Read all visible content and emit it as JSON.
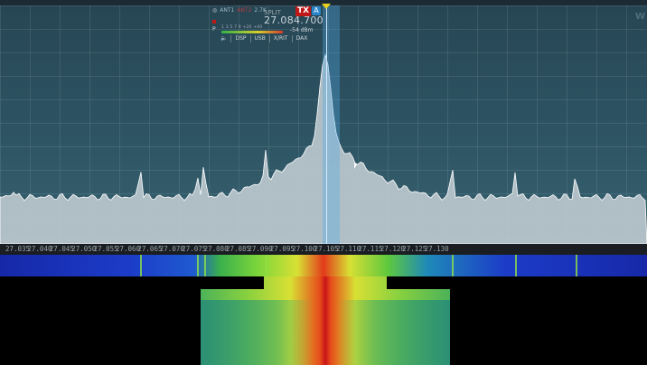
{
  "flag": {
    "ant1": "ANT1",
    "ant2": "ANT2",
    "bandwidth": "2.7K",
    "split": "SPLIT",
    "tx": "TX",
    "rx_letter": "A",
    "frequency": "27.084.700",
    "smeter_label": "P",
    "smeter_scale": "1  3  5  7  9  +20 +40",
    "smeter_dbm": "-54 dBm",
    "buttons": [
      "DSP",
      "USB",
      "X/RIT",
      "DAX"
    ],
    "speaker_icon": "speaker-icon"
  },
  "logo": "W",
  "freq_scale": [
    "27.035",
    "27.040",
    "27.045",
    "27.050",
    "27.055",
    "27.060",
    "27.065",
    "27.070",
    "27.075",
    "27.080",
    "27.085",
    "27.090",
    "27.095",
    "27.100",
    "27.105",
    "27.110",
    "27.115",
    "27.120",
    "27.125",
    "27.130"
  ],
  "colors": {
    "panadapter_bg": "#2c5261",
    "spectrum_fill": "#c2cdd3",
    "slice_band": "#50aae6",
    "tx_badge": "#c01818",
    "waterfall_low": "#1628a8",
    "waterfall_high": "#e23a1a"
  }
}
